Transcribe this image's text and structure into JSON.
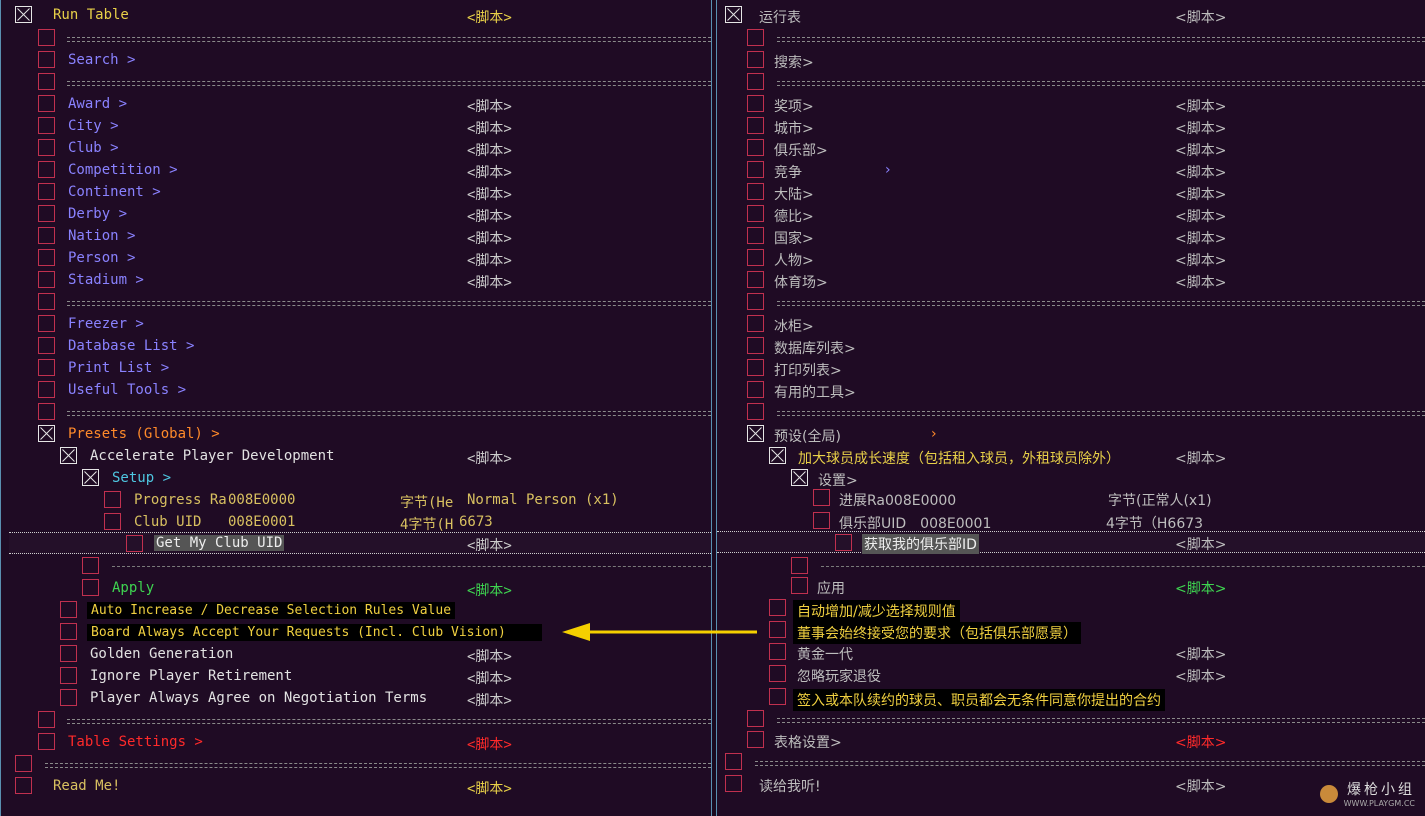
{
  "script_tag": "<脚本>",
  "left": {
    "run_table": "Run Table",
    "separator": "==================================================================================",
    "search": "Search >",
    "award": "Award >",
    "city": "City >",
    "club": "Club >",
    "competition": "Competition >",
    "continent": "Continent >",
    "derby": "Derby >",
    "nation": "Nation >",
    "person": "Person >",
    "stadium": "Stadium >",
    "freezer": "Freezer >",
    "database_list": "Database List >",
    "print_list": "Print List >",
    "useful_tools": "Useful Tools >",
    "presets": "Presets (Global) >",
    "accelerate": "Accelerate Player Development",
    "setup": "Setup >",
    "progress_label": "Progress Ra",
    "progress_addr": "008E0000",
    "progress_type": "字节(He",
    "progress_value": "Normal Person (x1)",
    "clubuid_label": "Club UID",
    "clubuid_addr": "008E0001",
    "clubuid_type": "4字节(H",
    "clubuid_value": "6673",
    "get_my_club": "Get My Club UID",
    "apply": "Apply",
    "auto_increase": "Auto Increase / Decrease Selection Rules Value",
    "board_accept": "Board Always Accept Your Requests (Incl. Club Vision)",
    "golden": "Golden Generation",
    "ignore_retire": "Ignore Player Retirement",
    "player_agree": "Player Always Agree on Negotiation Terms",
    "table_settings": "Table Settings >",
    "read_me": "Read Me!"
  },
  "right": {
    "run_table": "运行表",
    "search": "搜索>",
    "award": "奖项>",
    "city": "城市>",
    "club": "俱乐部>",
    "competition": "竞争",
    "competition_arrow": "›",
    "continent": "大陆>",
    "derby": "德比>",
    "nation": "国家>",
    "person": "人物>",
    "stadium": "体育场>",
    "freezer": "冰柜>",
    "database_list": "数据库列表>",
    "print_list": "打印列表>",
    "useful_tools": "有用的工具>",
    "presets": "预设(全局)",
    "presets_arrow": "›",
    "accelerate": "加大球员成长速度（包括租入球员，外租球员除外）",
    "setup": "设置>",
    "progress_label": "进展Ra008E0000",
    "progress_type": "字节(正常人(x1)",
    "clubuid_label": "俱乐部UID　008E0001",
    "clubuid_type": "4字节（H6673",
    "get_my_club": "获取我的俱乐部ID",
    "apply": "应用",
    "auto_increase": "自动增加/减少选择规则值",
    "board_accept": "董事会始终接受您的要求（包括俱乐部愿景）",
    "golden": "黄金一代",
    "ignore_retire": "忽略玩家退役",
    "player_agree": "签入或本队续约的球员、职员都会无条件同意你提出的合约",
    "table_settings": "表格设置>",
    "read_me": "读给我听!"
  },
  "watermark": {
    "title": "爆枪小组",
    "url": "WWW.PLAYGM.CC"
  },
  "colors": {
    "background": "#1f0b24",
    "checkbox": "#c0304f",
    "highlight_text": "#f0d040",
    "arrow": "#f5d000"
  }
}
